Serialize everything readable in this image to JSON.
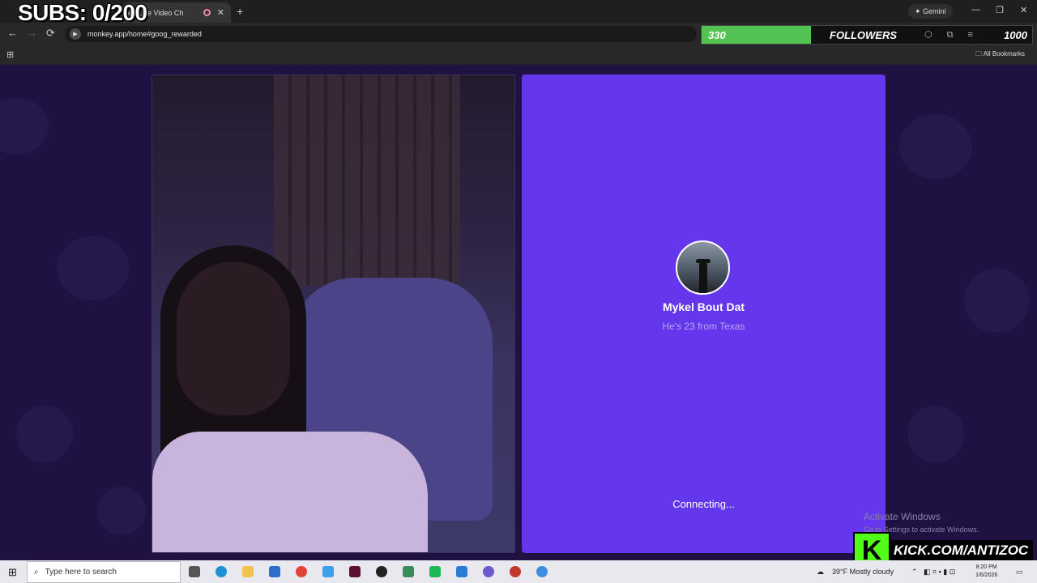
{
  "overlay": {
    "subs_text": "SUBS: 0/200",
    "followers": {
      "current": "330",
      "label": "FOLLOWERS",
      "goal": "1000",
      "progress_fraction": 0.33
    }
  },
  "browser": {
    "tab_title": "ee Live Video Ch",
    "new_tab_symbol": "+",
    "close_symbol": "✕",
    "gemini_label": "✦ Gemini",
    "url": "monkey.app/home#goog_rewarded",
    "all_bookmarks": "All Bookmarks",
    "window_controls": [
      "—",
      "❐",
      "✕"
    ],
    "nav": {
      "back": "←",
      "forward": "→",
      "reload": "⟳"
    },
    "apps_symbol": "⊞"
  },
  "page": {
    "match": {
      "name": "Mykel Bout Dat",
      "subtitle": "He's 23 from Texas",
      "status": "Connecting..."
    },
    "background_color": "#1f1142",
    "panel_color": "#6436ec"
  },
  "watermark": {
    "line1": "Activate Windows",
    "line2": "Go to Settings to activate Windows."
  },
  "kick": {
    "logo": "K",
    "url": "KICK.COM/ANTIZOC"
  },
  "taskbar": {
    "start_symbol": "⊞",
    "search_placeholder": "Type here to search",
    "weather": "39°F  Mostly cloudy",
    "time": "8:20 PM",
    "date": "1/6/2026"
  }
}
